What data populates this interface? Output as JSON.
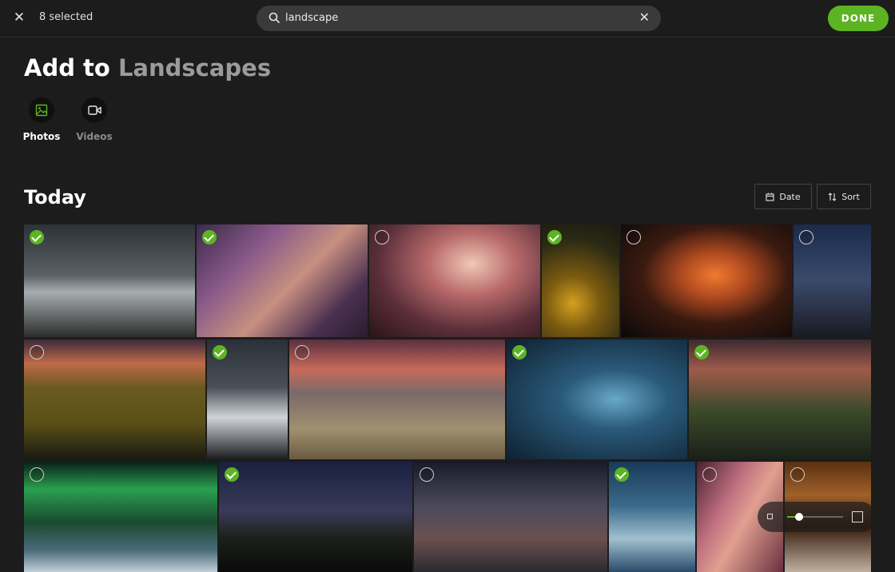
{
  "topbar": {
    "selected_text": "8 selected",
    "search_value": "landscape",
    "done_label": "DONE"
  },
  "heading": {
    "prefix": "Add to",
    "album": "Landscapes"
  },
  "media_tabs": [
    {
      "label": "Photos",
      "icon": "image-icon",
      "active": true
    },
    {
      "label": "Videos",
      "icon": "video-icon",
      "active": false
    }
  ],
  "section": {
    "title": "Today",
    "date_label": "Date",
    "sort_label": "Sort"
  },
  "colors": {
    "accent": "#5db423",
    "background": "#1c1c1c",
    "search_bg": "#3a3a3a"
  },
  "photos": [
    {
      "subject": "snowy-mountain-valley",
      "selected": true
    },
    {
      "subject": "slot-canyon-purple",
      "selected": true
    },
    {
      "subject": "canyon-light-beam",
      "selected": false
    },
    {
      "subject": "sunflower-field",
      "selected": true
    },
    {
      "subject": "orange-canyon-dark",
      "selected": false
    },
    {
      "subject": "milky-way-dead-tree",
      "selected": false
    },
    {
      "subject": "sunflowers-sunset",
      "selected": false
    },
    {
      "subject": "snowy-peak-ice",
      "selected": true
    },
    {
      "subject": "mountain-range-sunset",
      "selected": false
    },
    {
      "subject": "ice-cave",
      "selected": true
    },
    {
      "subject": "waterfall-mountain",
      "selected": true
    },
    {
      "subject": "aurora-mountain",
      "selected": false
    },
    {
      "subject": "lake-dusk",
      "selected": true
    },
    {
      "subject": "milky-way-mountains",
      "selected": false
    },
    {
      "subject": "ice-waves-night",
      "selected": true
    },
    {
      "subject": "pink-slot-canyon",
      "selected": false
    },
    {
      "subject": "canyon-stream",
      "selected": false
    }
  ],
  "zoom": {
    "level": 0.22
  }
}
